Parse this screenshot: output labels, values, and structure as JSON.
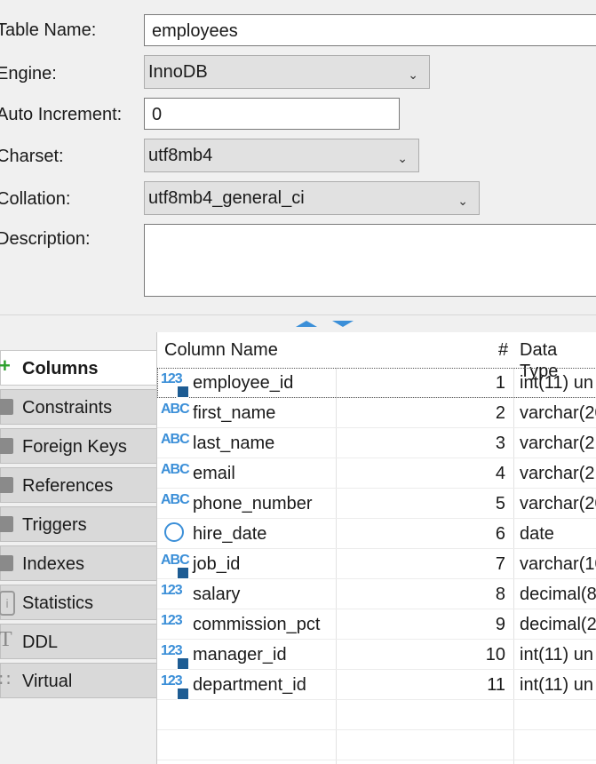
{
  "form": {
    "table_name_label": "Table Name:",
    "table_name_value": "employees",
    "engine_label": "Engine:",
    "engine_value": "InnoDB",
    "auto_increment_label": "Auto Increment:",
    "auto_increment_value": "0",
    "charset_label": "Charset:",
    "charset_value": "utf8mb4",
    "collation_label": "Collation:",
    "collation_value": "utf8mb4_general_ci",
    "description_label": "Description:",
    "description_value": ""
  },
  "tabs": [
    {
      "label": "Columns",
      "icon": "add-column-icon",
      "active": true
    },
    {
      "label": "Constraints",
      "icon": "key-icon"
    },
    {
      "label": "Foreign Keys",
      "icon": "foreign-key-icon"
    },
    {
      "label": "References",
      "icon": "reference-icon"
    },
    {
      "label": "Triggers",
      "icon": "trigger-icon"
    },
    {
      "label": "Indexes",
      "icon": "index-icon"
    },
    {
      "label": "Statistics",
      "icon": "info-icon"
    },
    {
      "label": "DDL",
      "icon": "text-icon"
    },
    {
      "label": "Virtual",
      "icon": "virtual-icon"
    }
  ],
  "grid": {
    "headers": {
      "name": "Column Name",
      "num": "#",
      "type": "Data Type"
    },
    "rows": [
      {
        "icon": "123",
        "badge": "key",
        "name": "employee_id",
        "num": "1",
        "type": "int(11) un"
      },
      {
        "icon": "ABC",
        "name": "first_name",
        "num": "2",
        "type": "varchar(20"
      },
      {
        "icon": "ABC",
        "name": "last_name",
        "num": "3",
        "type": "varchar(2"
      },
      {
        "icon": "ABC",
        "name": "email",
        "num": "4",
        "type": "varchar(2"
      },
      {
        "icon": "ABC",
        "name": "phone_number",
        "num": "5",
        "type": "varchar(20"
      },
      {
        "icon": "clock",
        "name": "hire_date",
        "num": "6",
        "type": "date"
      },
      {
        "icon": "ABC",
        "badge": "fk",
        "name": "job_id",
        "num": "7",
        "type": "varchar(10"
      },
      {
        "icon": "123",
        "name": "salary",
        "num": "8",
        "type": "decimal(8"
      },
      {
        "icon": "123",
        "name": "commission_pct",
        "num": "9",
        "type": "decimal(2"
      },
      {
        "icon": "123",
        "badge": "fk",
        "name": "manager_id",
        "num": "10",
        "type": "int(11) un"
      },
      {
        "icon": "123",
        "badge": "fk",
        "name": "department_id",
        "num": "11",
        "type": "int(11) un"
      }
    ]
  },
  "colors": {
    "accent": "#3b8fd8"
  }
}
